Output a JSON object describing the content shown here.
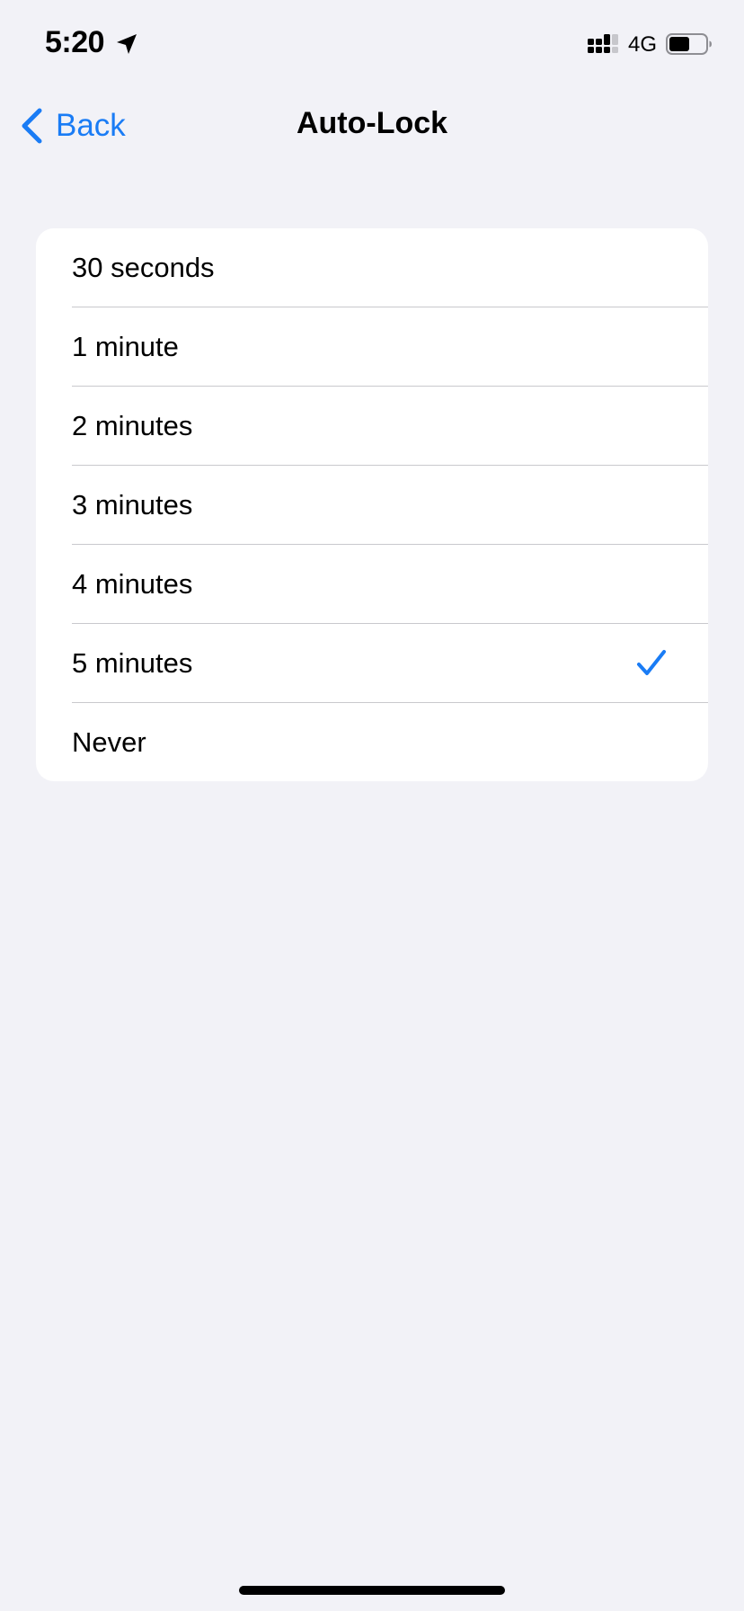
{
  "status_bar": {
    "time": "5:20",
    "network": "4G",
    "icons": [
      "location-arrow-icon",
      "cellular-signal-icon",
      "battery-icon"
    ]
  },
  "nav": {
    "back_label": "Back",
    "title": "Auto-Lock"
  },
  "options": [
    {
      "label": "30 seconds",
      "selected": false
    },
    {
      "label": "1 minute",
      "selected": false
    },
    {
      "label": "2 minutes",
      "selected": false
    },
    {
      "label": "3 minutes",
      "selected": false
    },
    {
      "label": "4 minutes",
      "selected": false
    },
    {
      "label": "5 minutes",
      "selected": true
    },
    {
      "label": "Never",
      "selected": false
    }
  ],
  "colors": {
    "accent": "#1A7CF5",
    "background": "#F2F2F7",
    "card": "#FFFFFF",
    "separator": "#C9C9CD"
  }
}
